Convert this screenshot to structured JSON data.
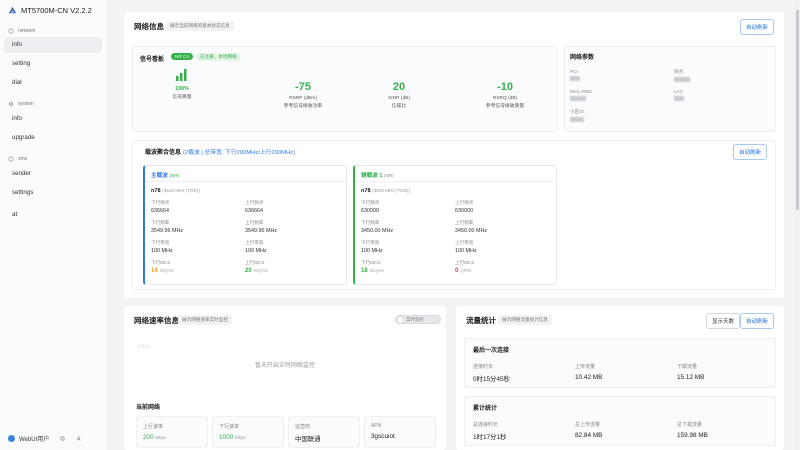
{
  "sidebar": {
    "brand": "MT5700M-CN V2.2.2",
    "sections": [
      {
        "title": "network",
        "items": [
          "info",
          "setting",
          "dial"
        ]
      },
      {
        "title": "system",
        "items": [
          "info",
          "upgrade"
        ]
      },
      {
        "title": "sms",
        "items": [
          "sender",
          "settings"
        ]
      }
    ],
    "extra_item": "at",
    "footer_user": "WebUI用户"
  },
  "network_info": {
    "title": "网络信息",
    "subtitle": "展示当前网络的基本状态信息",
    "refresh_label": "自动刷新",
    "signal": {
      "title": "信号看板",
      "badge": "NR CA",
      "status_tag": "已注册，本地网络",
      "quality_value": "100%",
      "quality_label": "信号质量",
      "metrics": [
        {
          "value": "-75",
          "label1": "RSRP (dBm)",
          "label2": "参考信号接收功率"
        },
        {
          "value": "20",
          "label1": "SINR (dB)",
          "label2": "信噪比"
        },
        {
          "value": "-10",
          "label1": "RSRQ (dB)",
          "label2": "参考信号接收质量"
        }
      ]
    },
    "params": {
      "title": "网络参数",
      "labels": [
        "PCI",
        "频点",
        "MCC-MNC",
        "LAC",
        "小区ID"
      ]
    },
    "ca": {
      "title": "载波聚合信息",
      "summary": "(2载波 | 总带宽: 下行200MHz/上行200MHz)",
      "refresh_label": "自动刷新",
      "carriers": [
        {
          "name": "主载波",
          "tag": "(NR)",
          "band": "n78",
          "band_detail": "(3549 MHz (TDD))",
          "fields": [
            {
              "k": "下行频点",
              "v": "636664"
            },
            {
              "k": "上行频点",
              "v": "636664"
            },
            {
              "k": "下行频率",
              "v": "3549.96 MHz"
            },
            {
              "k": "上行频率",
              "v": "3549.96 MHz"
            },
            {
              "k": "下行带宽",
              "v": "100 MHz"
            },
            {
              "k": "上行带宽",
              "v": "100 MHz"
            }
          ],
          "mcs": [
            {
              "k": "下行MCS",
              "v": "14",
              "u": "64QAM"
            },
            {
              "k": "上行MCS",
              "v": "20",
              "u": "64QAM"
            }
          ]
        },
        {
          "name": "辅载波 1",
          "tag": "(NR)",
          "band": "n78",
          "band_detail": "(3500 MHz (TDD))",
          "fields": [
            {
              "k": "下行频点",
              "v": "630000"
            },
            {
              "k": "上行频点",
              "v": "630000"
            },
            {
              "k": "下行频率",
              "v": "3450.00 MHz"
            },
            {
              "k": "上行频率",
              "v": "3450.00 MHz"
            },
            {
              "k": "下行带宽",
              "v": "100 MHz"
            },
            {
              "k": "上行带宽",
              "v": "100 MHz"
            }
          ],
          "mcs": [
            {
              "k": "下行MCS",
              "v": "18",
              "u": "64QAM"
            },
            {
              "k": "上行MCS",
              "v": "0",
              "u": "QPSK"
            }
          ]
        }
      ]
    }
  },
  "speed": {
    "title": "网络速率信息",
    "subtitle": "展示网络速率实时监控",
    "toggle_label": "实时监控",
    "chart_label": "Kbps",
    "empty_text": "暂未开启实时网络监控",
    "current": {
      "title": "当前网络",
      "items": [
        {
          "k": "上行速率",
          "v": "200",
          "u": "Mbps"
        },
        {
          "k": "下行速率",
          "v": "1000",
          "u": "Mbps"
        },
        {
          "k": "运营商",
          "v": "中国联通"
        },
        {
          "k": "APN",
          "v": "3gscuiot"
        }
      ]
    }
  },
  "traffic": {
    "title": "流量统计",
    "subtitle": "展示网络流量统计信息",
    "show_days_label": "显示天数",
    "refresh_label": "自动刷新",
    "last": {
      "title": "最后一次连接",
      "items": [
        {
          "k": "连接时长",
          "v": "0时15分45秒"
        },
        {
          "k": "上传流量",
          "v": "10.42 MB"
        },
        {
          "k": "下载流量",
          "v": "15.12 MB"
        }
      ]
    },
    "total": {
      "title": "累计统计",
      "items": [
        {
          "k": "总连接时长",
          "v": "1时17分1秒"
        },
        {
          "k": "总上传流量",
          "v": "82.84 MB"
        },
        {
          "k": "总下载流量",
          "v": "159.98 MB"
        }
      ]
    }
  },
  "colors": {
    "accent": "#1a6fd6",
    "good": "#35b04d",
    "warn": "#e79a1a",
    "bad": "#e03a3a"
  }
}
